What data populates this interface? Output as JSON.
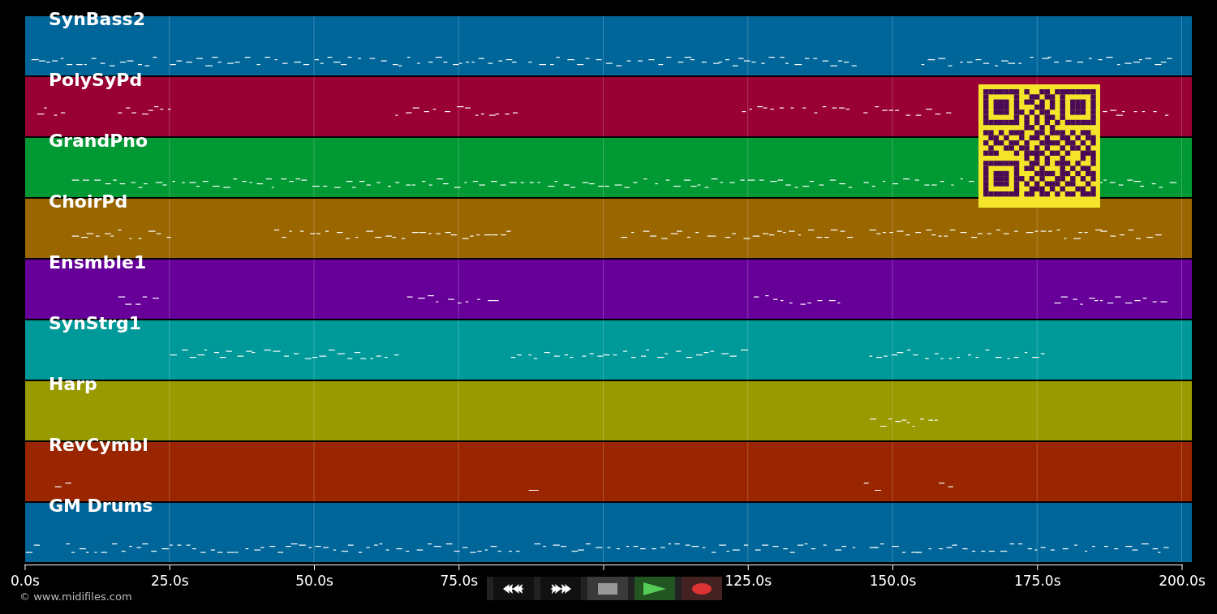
{
  "tracks": [
    {
      "name": "SynBass2",
      "color": "#006699"
    },
    {
      "name": "PolySyPd",
      "color": "#990033"
    },
    {
      "name": "GrandPno",
      "color": "#009933"
    },
    {
      "name": "ChoirPd",
      "color": "#996600"
    },
    {
      "name": "Ensmble1",
      "color": "#660099"
    },
    {
      "name": "SynStrg1",
      "color": "#009999"
    },
    {
      "name": "Harp",
      "color": "#999900"
    },
    {
      "name": "RevCymbl",
      "color": "#992600"
    },
    {
      "name": "GM Drums",
      "color": "#006699"
    }
  ],
  "axis": {
    "ticks": [
      "0.0s",
      "25.0s",
      "50.0s",
      "75.0s",
      "125.0s",
      "150.0s",
      "175.0s",
      "200.0s"
    ]
  },
  "transport": [
    {
      "kind": "rewind"
    },
    {
      "kind": "forward"
    },
    {
      "kind": "stop"
    },
    {
      "kind": "play"
    },
    {
      "kind": "record"
    }
  ],
  "footer": {
    "credit": "© www.midifiles.com"
  }
}
